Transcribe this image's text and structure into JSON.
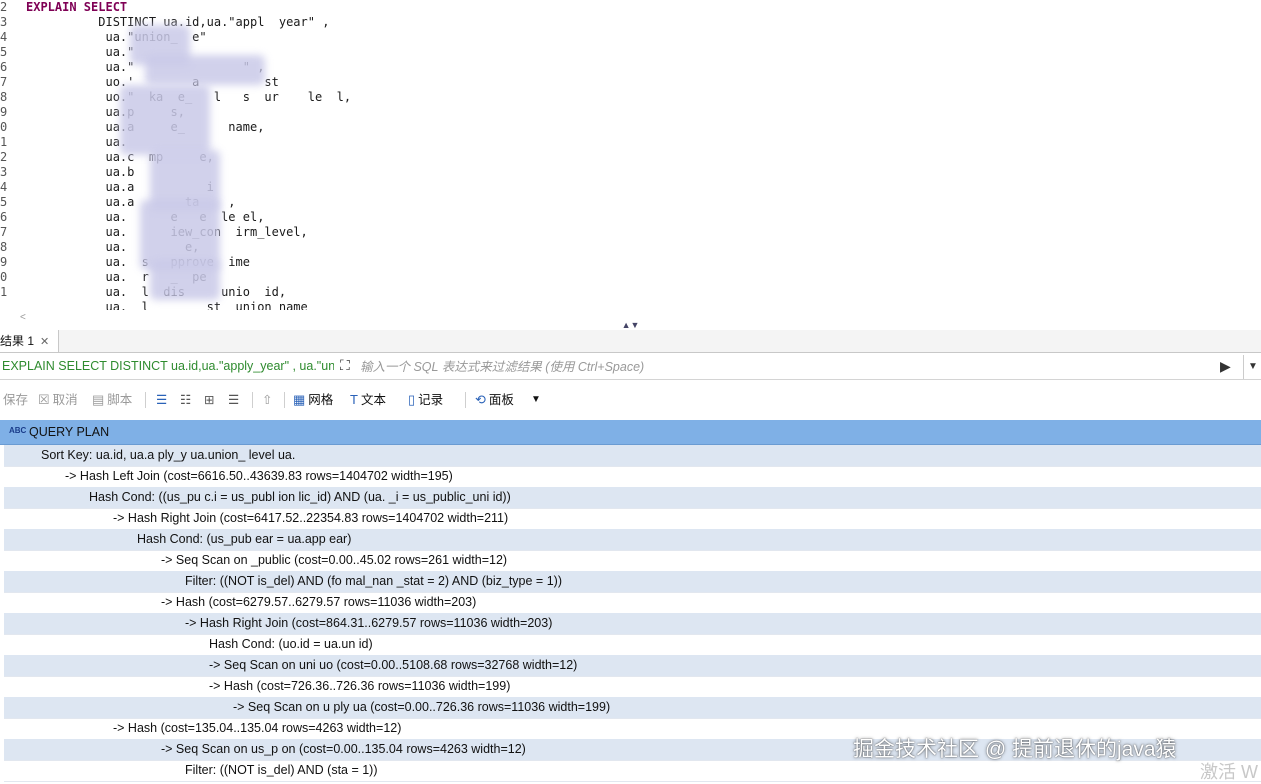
{
  "editor": {
    "lines": [
      {
        "num": "2",
        "text": "EXPLAIN SELECT",
        "keyword": true
      },
      {
        "num": "3",
        "text": "          DISTINCT ua.id,ua.\"appl  year\" ,",
        "keyword": false
      },
      {
        "num": "4",
        "text": "           ua.\"union_  e\"",
        "keyword": false
      },
      {
        "num": "5",
        "text": "           ua.\"",
        "keyword": false
      },
      {
        "num": "6",
        "text": "           ua.\"               \" ,",
        "keyword": false
      },
      {
        "num": "7",
        "text": "           uo.'        a         st",
        "keyword": false
      },
      {
        "num": "8",
        "text": "           uo.\"  ka  e_   l   s  ur    le  l,",
        "keyword": false
      },
      {
        "num": "9",
        "text": "           ua.p     s,",
        "keyword": false
      },
      {
        "num": "0",
        "text": "           ua.a     e_      name,",
        "keyword": false
      },
      {
        "num": "1",
        "text": "           ua.",
        "keyword": false
      },
      {
        "num": "2",
        "text": "           ua.c  mp     e,",
        "keyword": false
      },
      {
        "num": "3",
        "text": "           ua.b",
        "keyword": false
      },
      {
        "num": "4",
        "text": "           ua.a          i",
        "keyword": false
      },
      {
        "num": "5",
        "text": "           ua.a       ta    ,",
        "keyword": false
      },
      {
        "num": "6",
        "text": "           ua.      e   e  le el,",
        "keyword": false
      },
      {
        "num": "7",
        "text": "           ua.      iew_con  irm_level,",
        "keyword": false
      },
      {
        "num": "8",
        "text": "           ua.        e,",
        "keyword": false
      },
      {
        "num": "9",
        "text": "           ua.  s   pprove  ime",
        "keyword": false
      },
      {
        "num": "0",
        "text": "           ua.  r   _  pe",
        "keyword": false
      },
      {
        "num": "1",
        "text": "           ua.  l  dis     unio  id,",
        "keyword": false
      },
      {
        "num": "",
        "text": "           ua.  l        st  union_name",
        "keyword": false
      }
    ]
  },
  "results": {
    "tab_label": "结果 1",
    "query_label": "EXPLAIN SELECT DISTINCT ua.id,ua.\"apply_year\" , ua.\"uni",
    "filter_placeholder": "输入一个 SQL 表达式来过滤结果 (使用 Ctrl+Space)",
    "toolbar": {
      "save": "保存",
      "cancel": "取消",
      "script": "脚本",
      "grid": "网格",
      "text": "文本",
      "record": "记录",
      "panel": "面板"
    },
    "column_header": "QUERY PLAN",
    "column_type_badge": "ABC",
    "rows": [
      {
        "indent": 0,
        "text": "Sort Key: ua.id, ua.a  ply_y      ua.union_                    level  ua.",
        "alt": true
      },
      {
        "indent": 1,
        "text": "->  Hash Left Join  (cost=6616.50..43639.83 rows=1404702 width=195)",
        "alt": false
      },
      {
        "indent": 2,
        "text": "Hash Cond: ((us_pu   c.i    = us_publ     ion    lic_id) AND (ua.       _i     = us_public_uni          id))",
        "alt": true
      },
      {
        "indent": 3,
        "text": "->  Hash Right Join  (cost=6417.52..22354.83 rows=1404702 width=211)",
        "alt": false
      },
      {
        "indent": 4,
        "text": "Hash Cond: (us_pub      ear = ua.app      ear)",
        "alt": true
      },
      {
        "indent": 5,
        "text": "->  Seq Scan on     _public  (cost=0.00..45.02 rows=261 width=12)",
        "alt": false
      },
      {
        "indent": 6,
        "text": "Filter: ((NOT is_del) AND (fo  mal_nan       _stat    = 2) AND (biz_type = 1))",
        "alt": true
      },
      {
        "indent": 5,
        "text": "->  Hash  (cost=6279.57..6279.57 rows=11036 width=203)",
        "alt": false
      },
      {
        "indent": 6,
        "text": "->  Hash Right Join  (cost=864.31..6279.57 rows=11036 width=203)",
        "alt": true
      },
      {
        "indent": 7,
        "text": "Hash Cond: (uo.id = ua.un      id)",
        "alt": false
      },
      {
        "indent": 7,
        "text": "->  Seq Scan on uni                          uo  (cost=0.00..5108.68 rows=32768 width=12)",
        "alt": true
      },
      {
        "indent": 7,
        "text": "->  Hash  (cost=726.36..726.36 rows=11036 width=199)",
        "alt": false
      },
      {
        "indent": 8,
        "text": "->  Seq Scan on u       ply ua  (cost=0.00..726.36 rows=11036 width=199)",
        "alt": true
      },
      {
        "indent": 3,
        "text": "->  Hash  (cost=135.04..135.04 rows=4263 width=12)",
        "alt": false
      },
      {
        "indent": 5,
        "text": "->  Seq Scan on us_p            on  (cost=0.00..135.04 rows=4263 width=12)",
        "alt": true
      },
      {
        "indent": 6,
        "text": "Filter: ((NOT is_del) AND (sta    = 1))",
        "alt": false
      }
    ]
  },
  "watermark": "掘金技术社区 @ 提前退休的java猿",
  "activate_text": "激活 W",
  "colors": {
    "header_bg": "#7fb0e6",
    "alt_row_bg": "#dde6f2",
    "keyword": "#7f0055",
    "query_label": "#2e8b2e"
  }
}
